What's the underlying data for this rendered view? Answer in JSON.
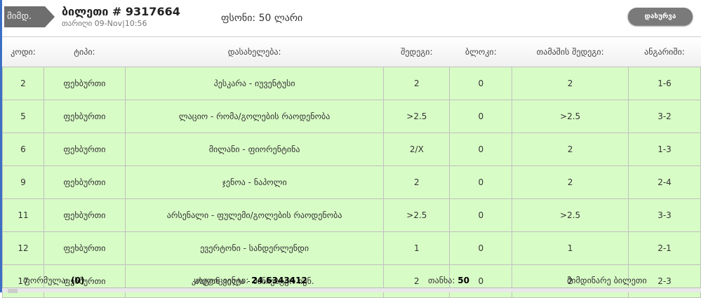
{
  "header": {
    "tag": "მიმდ.",
    "title": "ბილეთი # 9317664",
    "date": "თარიღი 09-Nov|10:56",
    "price": "ფსონი: 50 ლარი",
    "close_label": "დახურვა"
  },
  "columns": [
    "კოდი:",
    "ტიპი:",
    "დასახელება:",
    "შედეგი:",
    "ბლოკი:",
    "თამაშის შედეგი:",
    "ანგარიში:"
  ],
  "rows": [
    [
      "2",
      "ფეხბურთი",
      "პესკარა - იუვენტუსი",
      "2",
      "0",
      "2",
      "1-6"
    ],
    [
      "5",
      "ფეხბურთი",
      "ლაციო - რომა/გოლების რაოდენობა",
      ">2.5",
      "0",
      ">2.5",
      "3-2"
    ],
    [
      "6",
      "ფეხბურთი",
      "მილანი - ფიორენტინა",
      "2/X",
      "0",
      "2",
      "1-3"
    ],
    [
      "9",
      "ფეხბურთი",
      "ჯენოა - ნაპოლი",
      "2",
      "0",
      "2",
      "2-4"
    ],
    [
      "11",
      "ფეხბურთი",
      "არსენალი - ფულემი/გოლების რაოდენობა",
      ">2.5",
      "0",
      ">2.5",
      "3-3"
    ],
    [
      "12",
      "ფეხბურთი",
      "ევერტონი - სანდერლენდი",
      "1",
      "0",
      "1",
      "2-1"
    ],
    [
      "17",
      "ფეხბურთი",
      "ასტონ ვილა - მანჩესტერ იუნ.",
      "2",
      "0",
      "2",
      "2-3"
    ]
  ],
  "footer": {
    "formula_label": "ფორმულა:",
    "formula_value": "(0)",
    "coef_label": "კოეფიციენტი:",
    "coef_value": "24.6343412",
    "amount_label": "თანხა:",
    "amount_value": "50",
    "status": "მიმდინარე ბილეთი"
  }
}
